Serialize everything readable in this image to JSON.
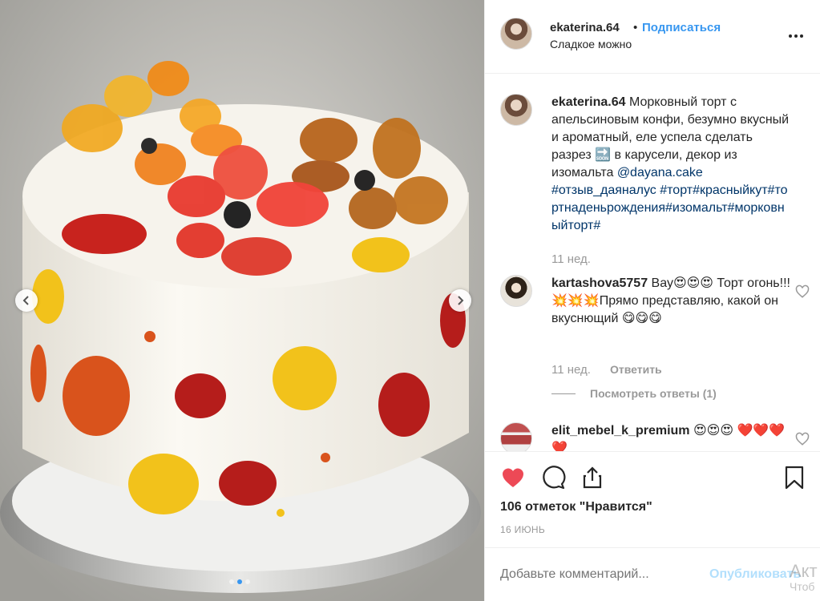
{
  "post": {
    "username": "ekaterina.64",
    "separator": "•",
    "follow_label": "Подписаться",
    "location": "Сладкое можно"
  },
  "caption": {
    "username": "ekaterina.64",
    "text_before": "Морковный торт с апельсиновым конфи, безумно вкусный и ароматный, еле успела сделать разрез ",
    "soon_emoji": "🔜",
    "text_after": " в карусели, декор из изомальта ",
    "mention": "@dayana.cake",
    "hashtags": "#отзыв_даяналус #торт#красныйкут#тортнаденьрождения#изомальт#морковныйторт#",
    "time": "11 нед."
  },
  "comments": [
    {
      "username": "kartashova5757",
      "text": "Вау😍😍😍 Торт огонь!!! 💥💥💥Прямо представляю, какой он вкуснющий 😋😋😋",
      "time": "11 нед.",
      "reply_label": "Ответить",
      "view_replies": "Посмотреть ответы (1)"
    },
    {
      "username": "elit_mebel_k_premium",
      "text": "😍😍😍 ❤️❤️❤️❤️",
      "time": "",
      "reply_label": ""
    }
  ],
  "actions": {
    "like_icon": "heart-filled-icon",
    "comment_icon": "comment-icon",
    "share_icon": "share-icon",
    "save_icon": "bookmark-icon",
    "like_color": "#ed4956"
  },
  "likes_text": "106 отметок \"Нравится\"",
  "date_text": "16 ИЮНЬ",
  "add_comment": {
    "placeholder": "Добавьте комментарий...",
    "publish_label": "Опубликовать"
  },
  "watermark": {
    "line1": "Акт",
    "line2": "Чтоб"
  },
  "carousel": {
    "slides": 3,
    "active_slide": 2
  }
}
